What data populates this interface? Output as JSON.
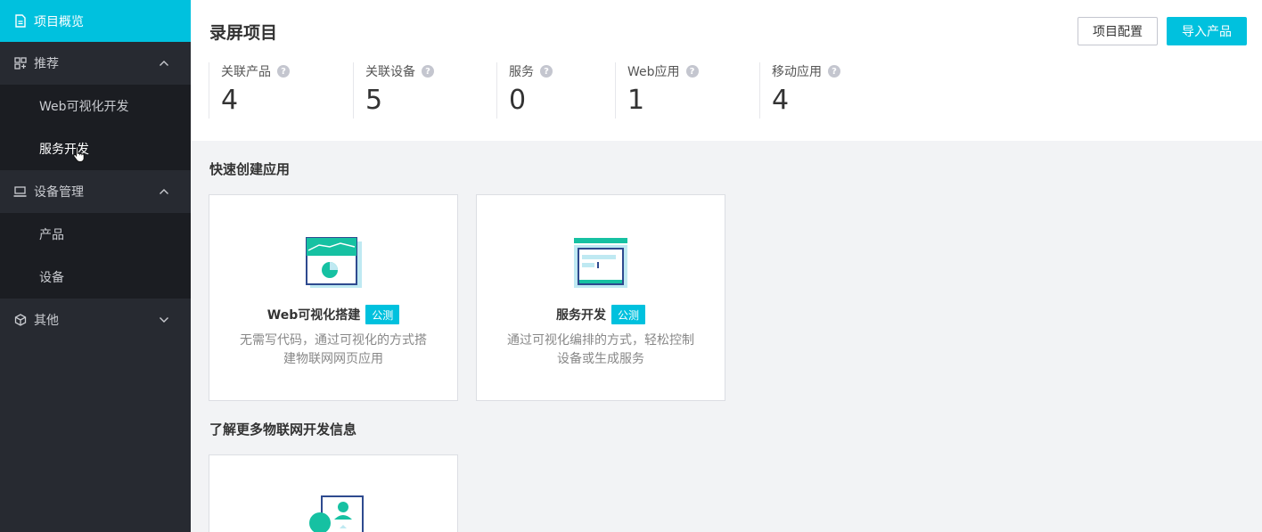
{
  "sidebar": {
    "top_item": {
      "label": "项目概览",
      "icon": "document-icon"
    },
    "groups": [
      {
        "label": "推荐",
        "icon": "grid-icon",
        "expanded": true,
        "items": [
          {
            "label": "Web可视化开发"
          },
          {
            "label": "服务开发"
          }
        ]
      },
      {
        "label": "设备管理",
        "icon": "device-icon",
        "expanded": true,
        "items": [
          {
            "label": "产品"
          },
          {
            "label": "设备"
          }
        ]
      },
      {
        "label": "其他",
        "icon": "cube-icon",
        "expanded": false,
        "items": []
      }
    ]
  },
  "header": {
    "title": "录屏项目",
    "config_button": "项目配置",
    "import_button": "导入产品"
  },
  "stats": [
    {
      "label": "关联产品",
      "value": "4"
    },
    {
      "label": "关联设备",
      "value": "5"
    },
    {
      "label": "服务",
      "value": "0"
    },
    {
      "label": "Web应用",
      "value": "1"
    },
    {
      "label": "移动应用",
      "value": "4"
    }
  ],
  "quick_create": {
    "title": "快速创建应用",
    "cards": [
      {
        "title": "Web可视化搭建",
        "badge": "公测",
        "desc": "无需写代码，通过可视化的方式搭建物联网网页应用"
      },
      {
        "title": "服务开发",
        "badge": "公测",
        "desc": "通过可视化编排的方式，轻松控制设备或生成服务"
      }
    ]
  },
  "learn_more": {
    "title": "了解更多物联网开发信息"
  },
  "help_glyph": "?",
  "colors": {
    "accent": "#00c1de",
    "sidebar_bg": "#272a31",
    "sidebar_sub_bg": "#1b1d22"
  }
}
